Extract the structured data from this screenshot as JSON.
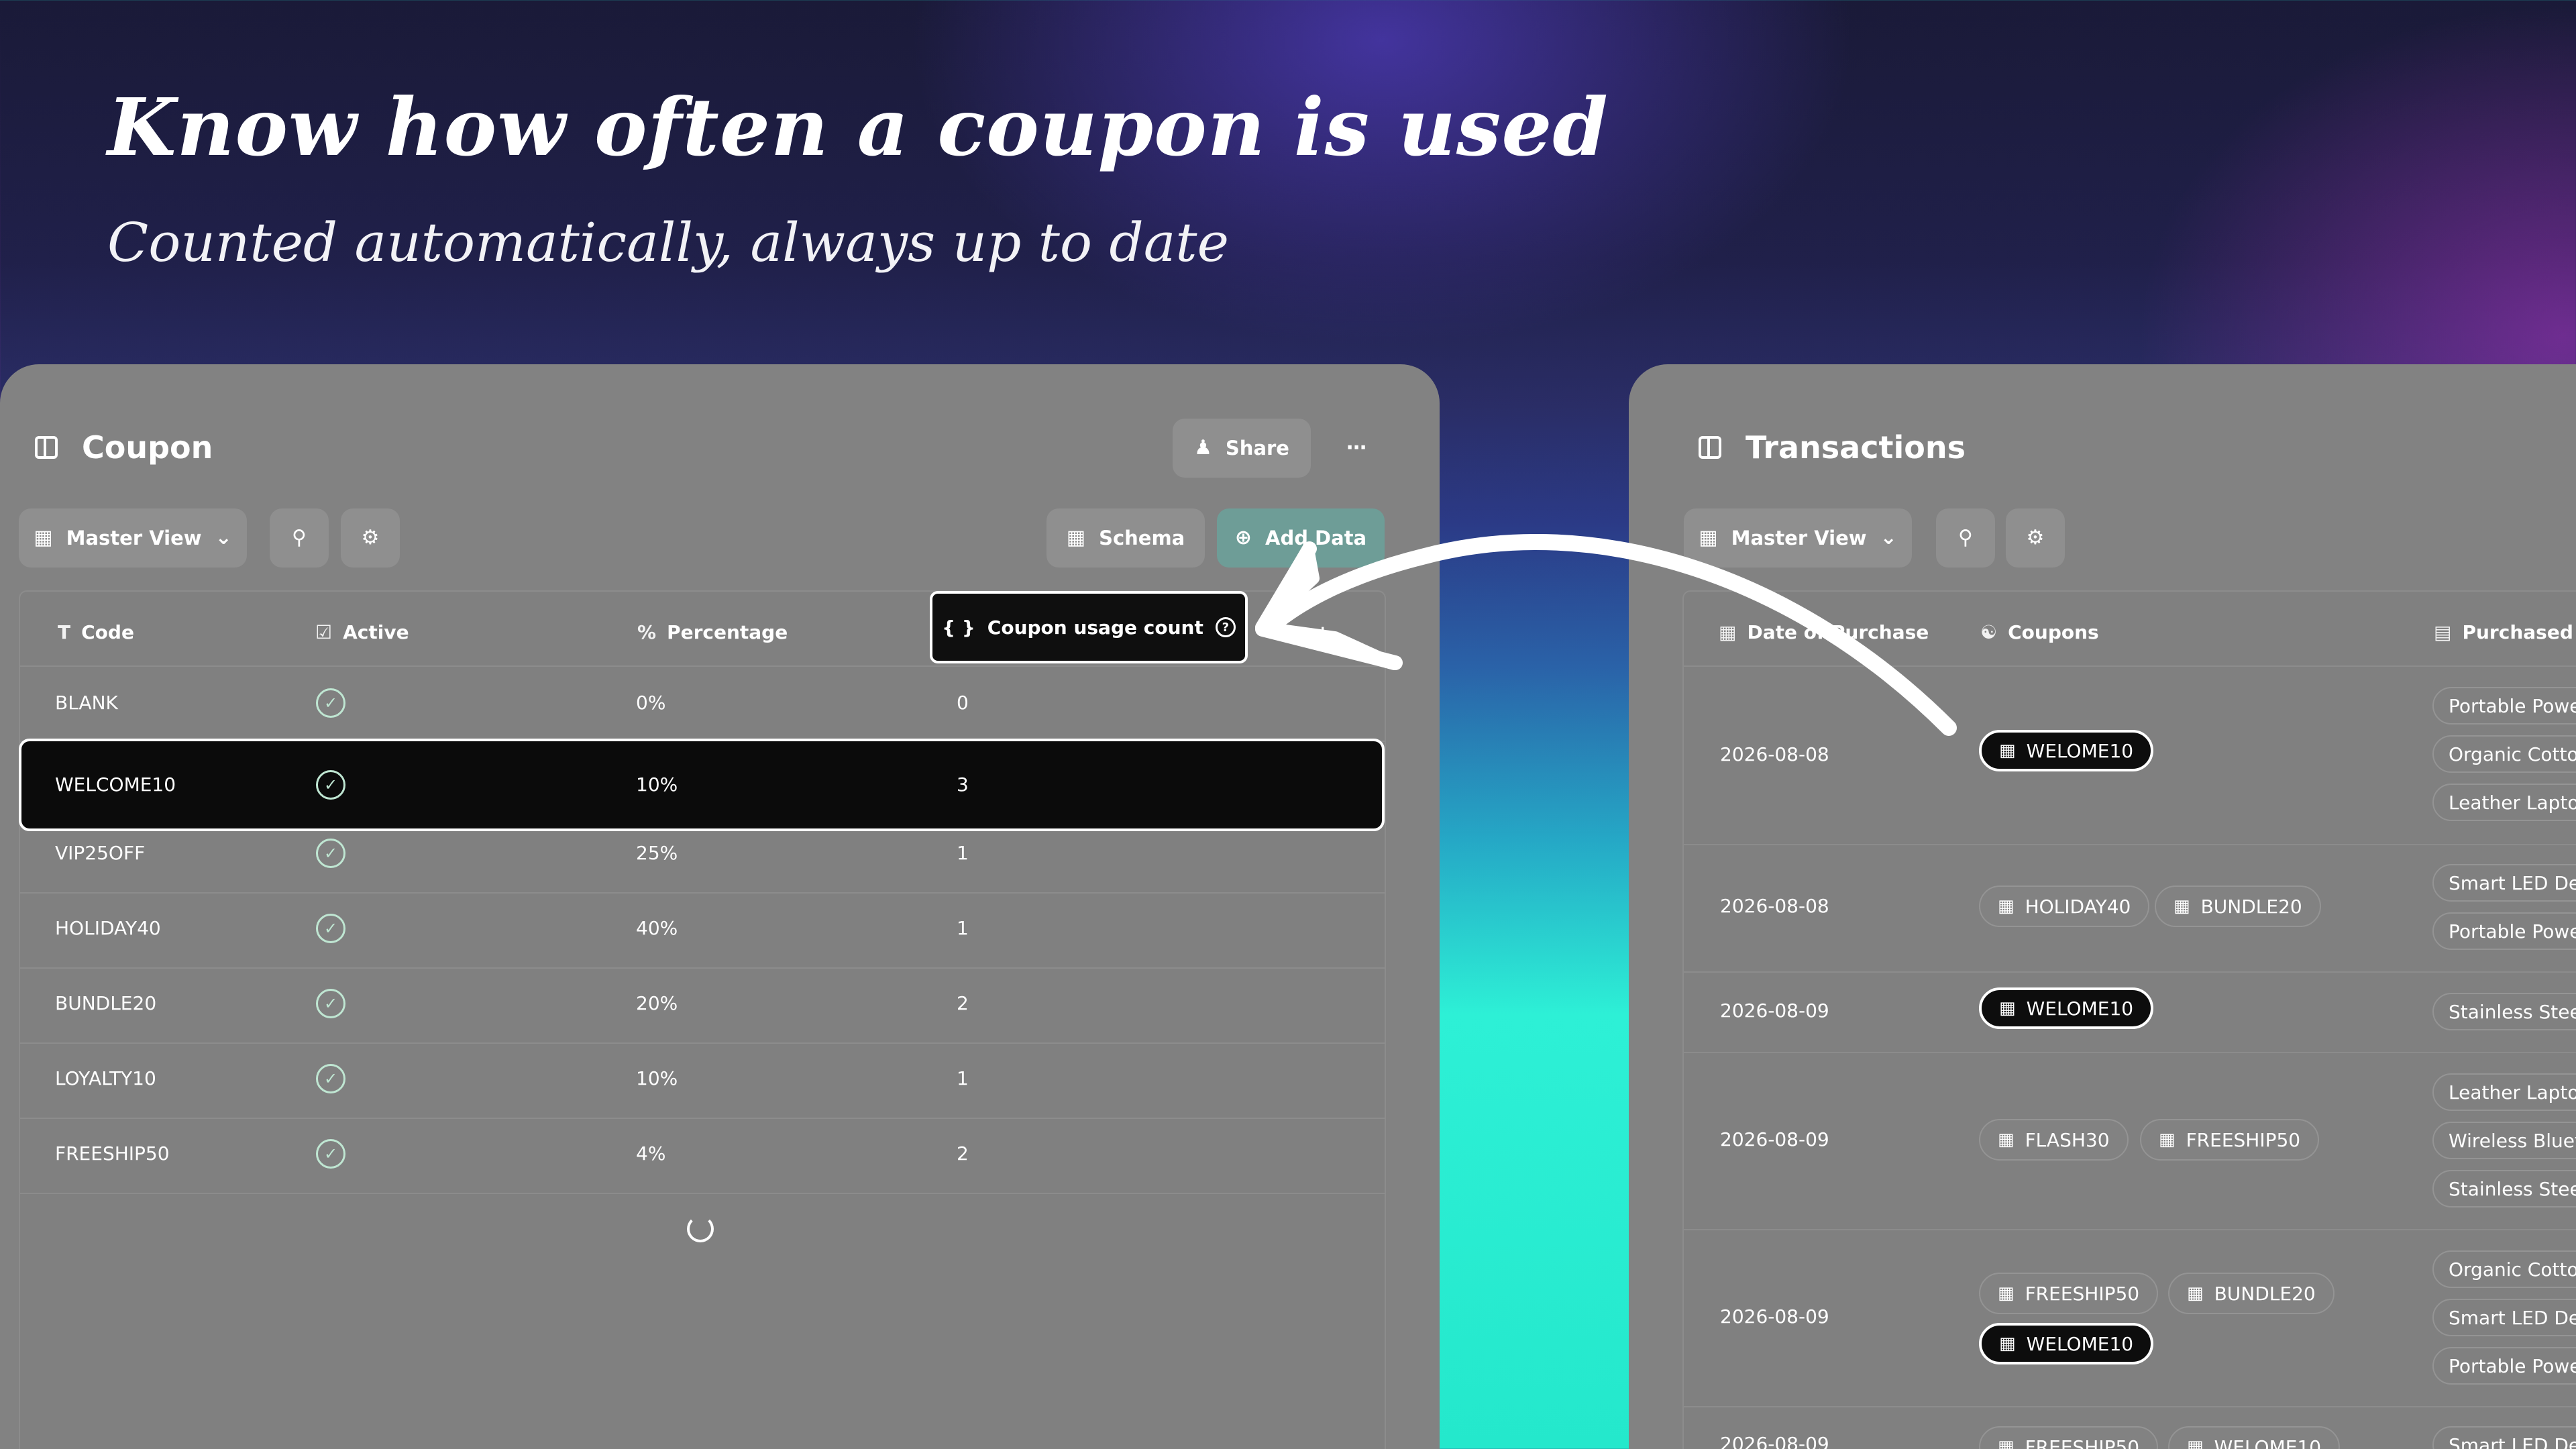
{
  "hero": {
    "title": "Know how often a coupon is used",
    "subtitle": "Counted automatically, always up to date"
  },
  "coupon_panel": {
    "title": "Coupon",
    "share_label": "Share",
    "more_icon": "ellipsis-icon",
    "view_label": "Master View",
    "schema_label": "Schema",
    "add_data_label": "Add Data",
    "columns": {
      "code": "Code",
      "active": "Active",
      "percentage": "Percentage",
      "usage": "Coupon usage count",
      "add": "+"
    },
    "rows": [
      {
        "code": "BLANK",
        "percentage": "0%",
        "usage": "0"
      },
      {
        "code": "WELCOME10",
        "percentage": "10%",
        "usage": "3"
      },
      {
        "code": "VIP25OFF",
        "percentage": "25%",
        "usage": "1"
      },
      {
        "code": "HOLIDAY40",
        "percentage": "40%",
        "usage": "1"
      },
      {
        "code": "BUNDLE20",
        "percentage": "20%",
        "usage": "2"
      },
      {
        "code": "LOYALTY10",
        "percentage": "10%",
        "usage": "1"
      },
      {
        "code": "FREESHIP50",
        "percentage": "4%",
        "usage": "2"
      }
    ]
  },
  "transactions_panel": {
    "title": "Transactions",
    "view_label": "Master View",
    "columns": {
      "date": "Date of Purchase",
      "coupons": "Coupons",
      "purchased": "Purchased it"
    },
    "rows": [
      {
        "date": "2026-08-08",
        "coupons": [
          "WELOME10"
        ],
        "items": [
          "Portable Powe",
          "Organic Cottor",
          "Leather Lapto"
        ]
      },
      {
        "date": "2026-08-08",
        "coupons": [
          "HOLIDAY40",
          "BUNDLE20"
        ],
        "items": [
          "Smart LED Des",
          "Portable Powe"
        ]
      },
      {
        "date": "2026-08-09",
        "coupons": [
          "WELOME10"
        ],
        "items": [
          "Stainless Stee"
        ]
      },
      {
        "date": "2026-08-09",
        "coupons": [
          "FLASH30",
          "FREESHIP50"
        ],
        "items": [
          "Leather Lapto",
          "Wireless Bluet",
          "Stainless Stee"
        ]
      },
      {
        "date": "2026-08-09",
        "coupons": [
          "FREESHIP50",
          "BUNDLE20",
          "WELOME10"
        ],
        "items": [
          "Organic Cottor",
          "Smart LED Des",
          "Portable Powe"
        ]
      },
      {
        "date": "2026-08-09",
        "coupons": [
          "FREESHIP50",
          "WELOME10"
        ],
        "items": [
          "Smart LED Des"
        ]
      }
    ]
  },
  "colors": {
    "panel": "#828282",
    "highlight": "#0b0b0b",
    "check": "#bfe6d2",
    "add_data_bg": "#6e9d97"
  }
}
